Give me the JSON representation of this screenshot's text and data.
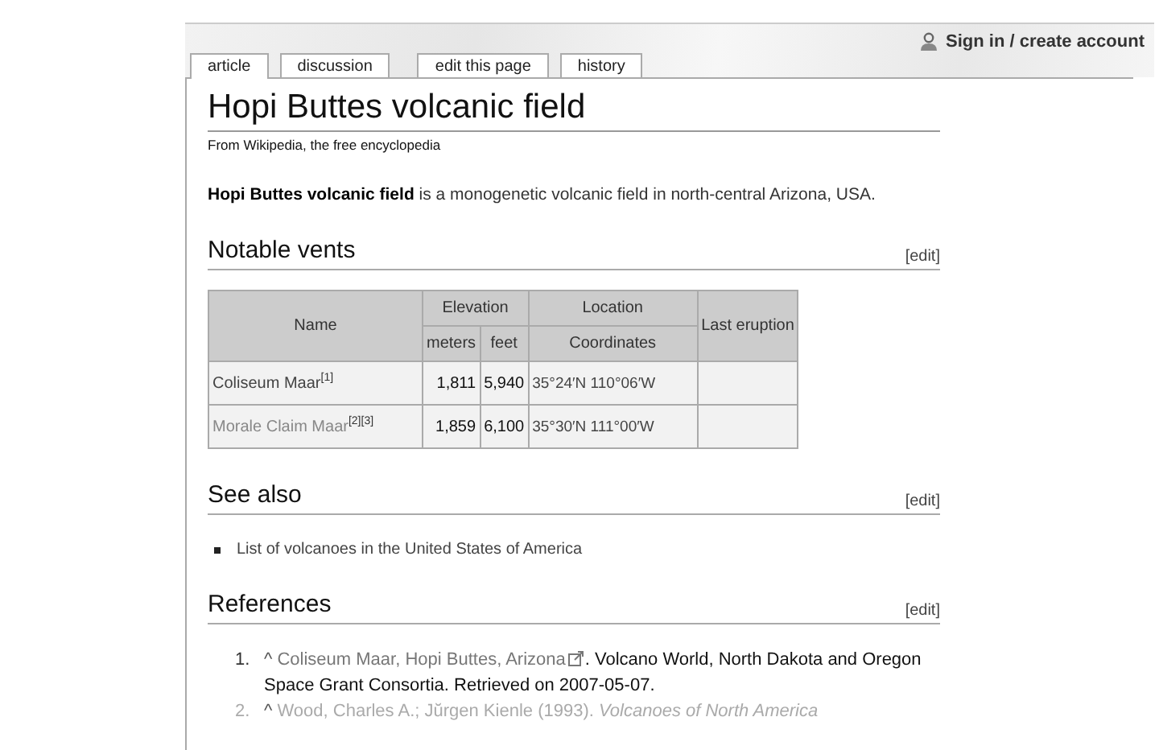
{
  "personal": {
    "label": "Sign in / create account"
  },
  "tabs": [
    {
      "label": "article",
      "selected": true
    },
    {
      "label": "discussion",
      "selected": false
    },
    {
      "label": "edit this page",
      "selected": false
    },
    {
      "label": "history",
      "selected": false
    }
  ],
  "title": "Hopi Buttes volcanic field",
  "subtitle": "From Wikipedia, the free encyclopedia",
  "intro": "**Hopi Buttes volcanic field** is a monogenetic volcanic field in north-central Arizona, USA.",
  "sections": [
    {
      "kind": "table",
      "heading": "Notable vents",
      "edit": "[edit]",
      "table": {
        "header": {
          "name": "Name",
          "elevation": "Elevation",
          "location": "Location",
          "last_eruption": "Last eruption",
          "meters": "meters",
          "feet": "feet",
          "coordinates": "Coordinates"
        },
        "rows": [
          {
            "name": "Coliseum Maar",
            "refs": "[1]",
            "new": false,
            "meters": "1,811",
            "feet": "5,940",
            "coordinates": "35°24′N 110°06′W"
          },
          {
            "name": "Morale Claim Maar",
            "refs": "[2][3]",
            "new": true,
            "meters": "1,859",
            "feet": "6,100",
            "coordinates": "35°30′N 111°00′W"
          }
        ]
      }
    },
    {
      "kind": "list",
      "heading": "See also",
      "edit": "[edit]",
      "items": [
        "List of volcanoes in the United States of America"
      ]
    },
    {
      "kind": "refs",
      "heading": "References",
      "edit": "[edit]",
      "refs": [
        {
          "number": "1.",
          "caret": "^",
          "link": "Coliseum Maar, Hopi Buttes, Arizona",
          "rest": ". Volcano World, North Dakota and Oregon Space Grant Consortia. Retrieved on 2007-05-07."
        },
        {
          "number": "2.",
          "caret": "^",
          "rest": "Wood, Charles A.; Jŭrgen Kienle (1993). *Volcanoes of North America*"
        }
      ]
    }
  ]
}
